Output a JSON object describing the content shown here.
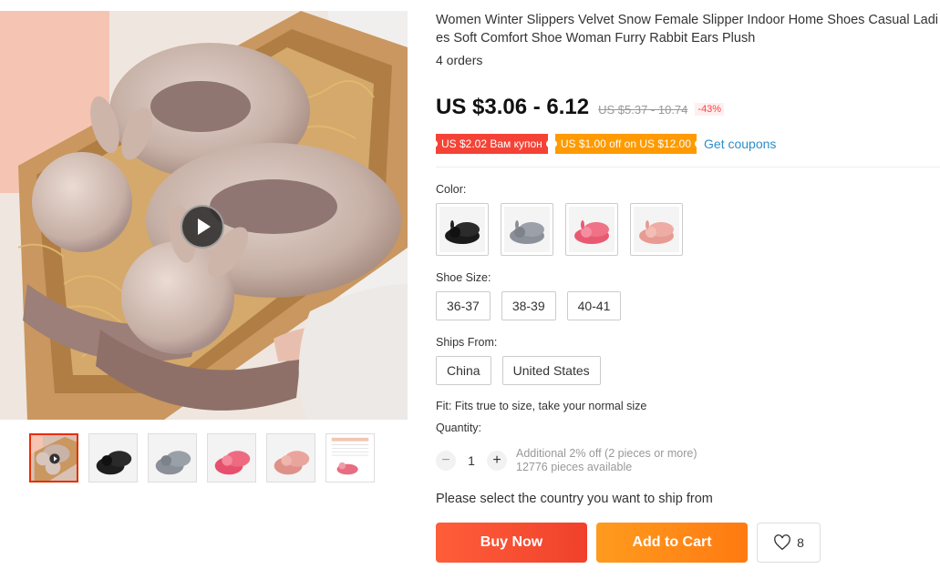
{
  "product": {
    "title": "Women Winter Slippers Velvet Snow Female Slipper Indoor Home Shoes Casual Ladies Soft Comfort Shoe Woman Furry Rabbit Ears Plush",
    "orders": "4 orders"
  },
  "price": {
    "current": "US $3.06 - 6.12",
    "original": "US $5.37 - 10.74",
    "discount": "-43%"
  },
  "coupons": {
    "first": "US $2.02 Вам купон",
    "second": "US $1.00 off on US $12.00",
    "get_label": "Get coupons"
  },
  "color": {
    "label": "Color:",
    "options": [
      "black-icon",
      "gray-icon",
      "rose-icon",
      "pink-icon"
    ],
    "swatches": [
      "#1a1a1a",
      "#8c9199",
      "#e85a72",
      "#e79b93"
    ]
  },
  "shoe_size": {
    "label": "Shoe Size:",
    "options": [
      "36-37",
      "38-39",
      "40-41"
    ]
  },
  "ships_from": {
    "label": "Ships From:",
    "options": [
      "China",
      "United States"
    ]
  },
  "fit": "Fit: Fits true to size, take your normal size",
  "quantity": {
    "label": "Quantity:",
    "minus": "−",
    "value": "1",
    "plus": "+",
    "discount_note": "Additional 2% off (2 pieces or more)",
    "available": "12776 pieces available"
  },
  "ship_message": "Please select the country you want to ship from",
  "actions": {
    "buy_now": "Buy Now",
    "add_to_cart": "Add to Cart",
    "wishlist_count": "8"
  },
  "colors": {
    "accent": "#e62e04",
    "buy_now": "#f0412b",
    "add_to_cart": "#ff7a11",
    "coupon_red": "#f44336",
    "coupon_orange": "#ff9a00",
    "link": "#2b8fc7"
  }
}
